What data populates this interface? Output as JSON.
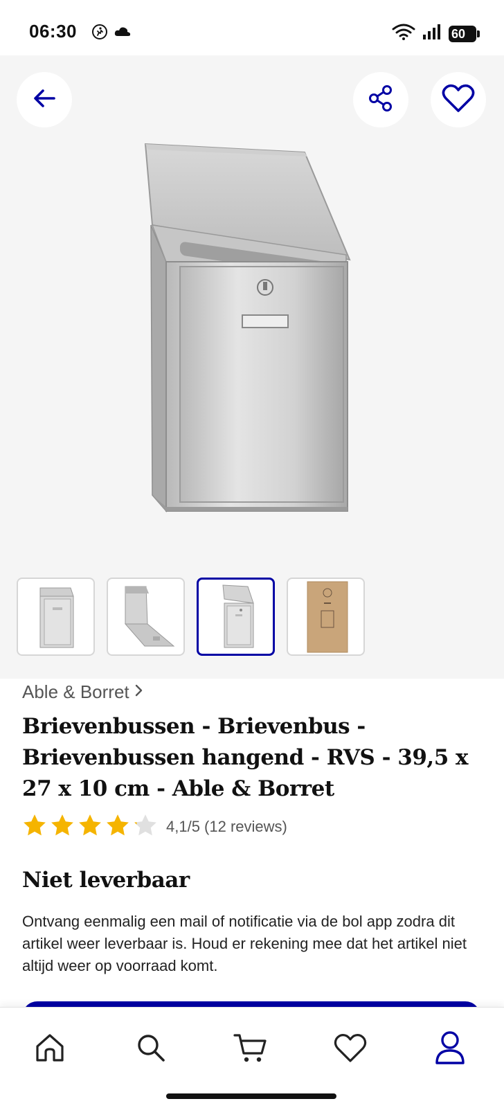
{
  "status_bar": {
    "time": "06:30",
    "battery": "60",
    "icons": [
      "activity-icon",
      "cloud-icon",
      "wifi-icon",
      "signal-icon",
      "battery-icon"
    ]
  },
  "gallery": {
    "thumbnails": [
      {
        "name": "mailbox-front",
        "active": false
      },
      {
        "name": "mailbox-open",
        "active": false
      },
      {
        "name": "mailbox-lid-open",
        "active": true
      },
      {
        "name": "mailbox-box",
        "active": false
      }
    ]
  },
  "product": {
    "brand": "Able & Borret",
    "title": "Brievenbussen - Brievenbus - Brievenbussen hangend - RVS - 39,5 x 27 x 10 cm - Able & Borret",
    "rating_value": 4.1,
    "rating_max": 5,
    "rating_text": "4,1/5 (12 reviews)",
    "availability": "Niet leverbaar",
    "notice": "Ontvang eenmalig een mail of notificatie via de bol app zodra dit artikel weer leverbaar is. Houd er rekening mee dat het artikel niet altijd weer op voorraad komt."
  },
  "bottom_nav": {
    "items": [
      "home-icon",
      "search-icon",
      "cart-icon",
      "heart-icon",
      "user-icon"
    ]
  },
  "colors": {
    "accent": "#0000a4",
    "star": "#f5b400",
    "star_empty": "#e0e0e0",
    "gallery_bg": "#f5f5f5"
  }
}
